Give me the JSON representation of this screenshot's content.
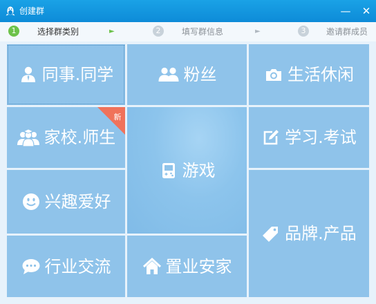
{
  "window": {
    "title": "创建群",
    "minimize": "—",
    "close": "✕"
  },
  "colors": {
    "titlebar": "#0d8bd8",
    "tile": "#8fc3ea",
    "active_step": "#6cc24a",
    "badge": "#f0725a"
  },
  "steps": [
    {
      "number": "1",
      "label": "选择群类别",
      "active": true
    },
    {
      "number": "2",
      "label": "填写群信息",
      "active": false
    },
    {
      "number": "3",
      "label": "邀请群成员",
      "active": false
    }
  ],
  "step_arrow": "►",
  "categories": {
    "colleagues": {
      "label": "同事.同学",
      "icon": "person-icon"
    },
    "fans": {
      "label": "粉丝",
      "icon": "users-icon"
    },
    "lifestyle": {
      "label": "生活休闲",
      "icon": "camera-icon"
    },
    "school": {
      "label": "家校.师生",
      "icon": "graduation-group-icon",
      "badge": "新"
    },
    "games": {
      "label": "游戏",
      "icon": "gamepad-icon"
    },
    "study": {
      "label": "学习.考试",
      "icon": "pencil-square-icon"
    },
    "hobbies": {
      "label": "兴趣爱好",
      "icon": "smile-icon"
    },
    "brands": {
      "label": "品牌.产品",
      "icon": "tag-icon"
    },
    "industry": {
      "label": "行业交流",
      "icon": "chat-bubble-icon"
    },
    "realestate": {
      "label": "置业安家",
      "icon": "home-icon"
    }
  }
}
